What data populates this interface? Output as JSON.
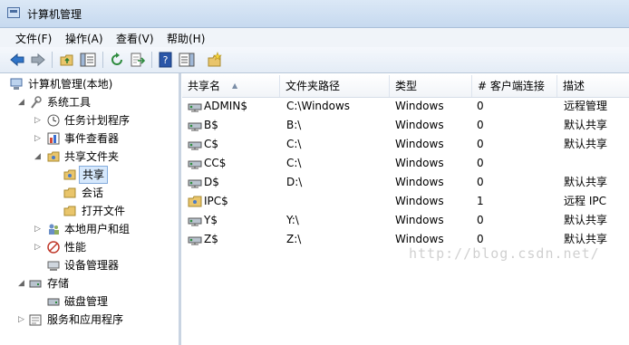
{
  "window": {
    "title": "计算机管理"
  },
  "menu": [
    "文件(F)",
    "操作(A)",
    "查看(V)",
    "帮助(H)"
  ],
  "tree": {
    "root": "计算机管理(本地)",
    "system_tools": "系统工具",
    "task_scheduler": "任务计划程序",
    "event_viewer": "事件查看器",
    "shared_folders": "共享文件夹",
    "shares": "共享",
    "sessions": "会话",
    "open_files": "打开文件",
    "local_users": "本地用户和组",
    "performance": "性能",
    "device_manager": "设备管理器",
    "storage": "存储",
    "disk_management": "磁盘管理",
    "services_apps": "服务和应用程序"
  },
  "list": {
    "columns": [
      "共享名",
      "文件夹路径",
      "类型",
      "# 客户端连接",
      "描述"
    ],
    "rows": [
      {
        "name": "ADMIN$",
        "path": "C:\\Windows",
        "type": "Windows",
        "conn": "0",
        "desc": "远程管理"
      },
      {
        "name": "B$",
        "path": "B:\\",
        "type": "Windows",
        "conn": "0",
        "desc": "默认共享"
      },
      {
        "name": "C$",
        "path": "C:\\",
        "type": "Windows",
        "conn": "0",
        "desc": "默认共享"
      },
      {
        "name": "CC$",
        "path": "C:\\",
        "type": "Windows",
        "conn": "0",
        "desc": ""
      },
      {
        "name": "D$",
        "path": "D:\\",
        "type": "Windows",
        "conn": "0",
        "desc": "默认共享"
      },
      {
        "name": "IPC$",
        "path": "",
        "type": "Windows",
        "conn": "1",
        "desc": "远程 IPC"
      },
      {
        "name": "Y$",
        "path": "Y:\\",
        "type": "Windows",
        "conn": "0",
        "desc": "默认共享"
      },
      {
        "name": "Z$",
        "path": "Z:\\",
        "type": "Windows",
        "conn": "0",
        "desc": "默认共享"
      }
    ]
  },
  "watermark": "http://blog.csdn.net/"
}
